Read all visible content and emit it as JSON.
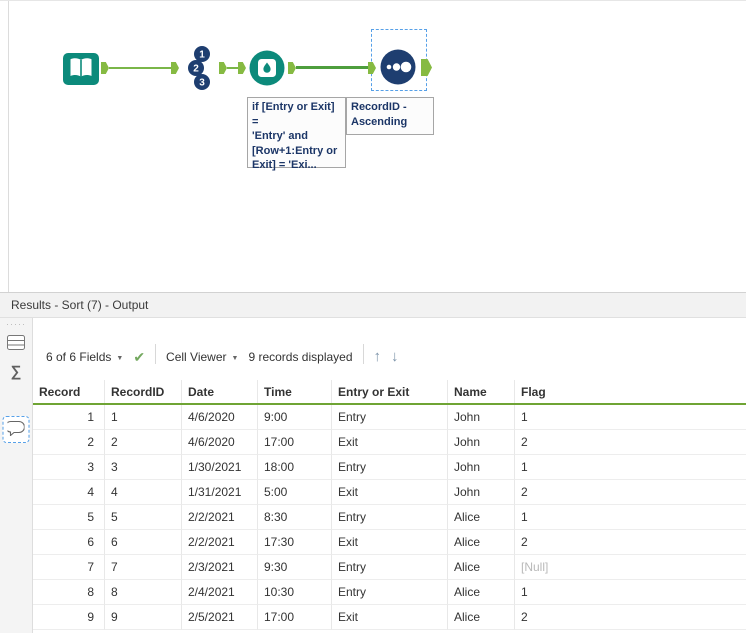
{
  "canvas": {
    "record_id_numbers": [
      "1",
      "2",
      "3"
    ],
    "annotations": {
      "formula": "if [Entry or Exit] =\n'Entry' and\n[Row+1:Entry or\nExit] = 'Exi...",
      "sort": "RecordID -\nAscending"
    }
  },
  "icons": {
    "dropdown_caret": "▼",
    "check": "✔",
    "up_arrow": "↑",
    "down_arrow": "↓",
    "sigma": "∑",
    "drag_dots": "·····"
  },
  "colors": {
    "connection_green": "#7ab648",
    "header_underline_green": "#6fa434",
    "tool_navy": "#1e3e70",
    "tool_teal": "#0c8a7b",
    "selection_blue": "#56a0e8"
  },
  "results": {
    "title": "Results - Sort (7) - Output",
    "toolbar": {
      "fields_selector": "6 of 6 Fields",
      "cell_viewer": "Cell Viewer",
      "records_text": "9 records displayed"
    },
    "table": {
      "columns": [
        "Record",
        "RecordID",
        "Date",
        "Time",
        "Entry or Exit",
        "Name",
        "Flag"
      ],
      "rows": [
        [
          "1",
          "1",
          "4/6/2020",
          "9:00",
          "Entry",
          "John",
          "1"
        ],
        [
          "2",
          "2",
          "4/6/2020",
          "17:00",
          "Exit",
          "John",
          "2"
        ],
        [
          "3",
          "3",
          "1/30/2021",
          "18:00",
          "Entry",
          "John",
          "1"
        ],
        [
          "4",
          "4",
          "1/31/2021",
          "5:00",
          "Exit",
          "John",
          "2"
        ],
        [
          "5",
          "5",
          "2/2/2021",
          "8:30",
          "Entry",
          "Alice",
          "1"
        ],
        [
          "6",
          "6",
          "2/2/2021",
          "17:30",
          "Exit",
          "Alice",
          "2"
        ],
        [
          "7",
          "7",
          "2/3/2021",
          "9:30",
          "Entry",
          "Alice",
          "[Null]"
        ],
        [
          "8",
          "8",
          "2/4/2021",
          "10:30",
          "Entry",
          "Alice",
          "1"
        ],
        [
          "9",
          "9",
          "2/5/2021",
          "17:00",
          "Exit",
          "Alice",
          "2"
        ]
      ]
    }
  }
}
